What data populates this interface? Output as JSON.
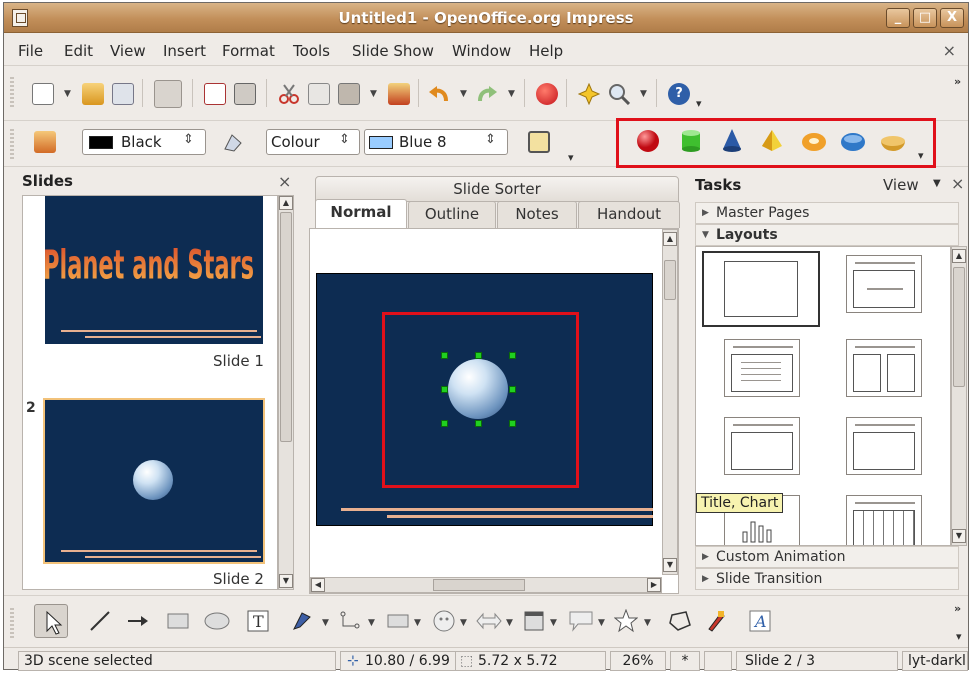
{
  "window": {
    "title": "Untitled1 - OpenOffice.org Impress",
    "buttons": [
      "_",
      "□",
      "X"
    ]
  },
  "menu": {
    "items": [
      "File",
      "Edit",
      "View",
      "Insert",
      "Format",
      "Tools",
      "Slide Show",
      "Window",
      "Help"
    ],
    "close": "×"
  },
  "line_toolbar": {
    "line_color": {
      "value": "Black",
      "swatch": "#000000"
    },
    "area_mode": "Colour",
    "area_color": {
      "value": "Blue 8",
      "swatch": "#99ccff"
    }
  },
  "shapes3d": [
    "sphere",
    "cylinder",
    "cone",
    "pyramid",
    "torus",
    "shell",
    "half-sphere"
  ],
  "slides_pane": {
    "title": "Slides",
    "close": "×",
    "slides": [
      {
        "caption": "Slide 1",
        "wordart": "Planet and Stars"
      },
      {
        "number": "2",
        "caption": "Slide 2"
      }
    ]
  },
  "center": {
    "sorter_tab": "Slide Sorter",
    "tabs": [
      "Normal",
      "Outline",
      "Notes",
      "Handout"
    ],
    "active_tab": "Normal"
  },
  "tasks": {
    "title": "Tasks",
    "view": "View",
    "close": "×",
    "master_pages": "Master Pages",
    "layouts": "Layouts",
    "custom_animation": "Custom Animation",
    "slide_transition": "Slide Transition",
    "tooltip": "Title, Chart"
  },
  "status": {
    "selection": "3D scene selected",
    "position": "10.80 / 6.99",
    "size": "5.72 x 5.72",
    "zoom": "26%",
    "modified": "*",
    "slide": "Slide 2 / 3",
    "master": "lyt-darkl"
  },
  "colors": {
    "highlight": "#e0101a",
    "slide_bg": "#0d2c52",
    "title_gradient": "#c28f5a"
  }
}
